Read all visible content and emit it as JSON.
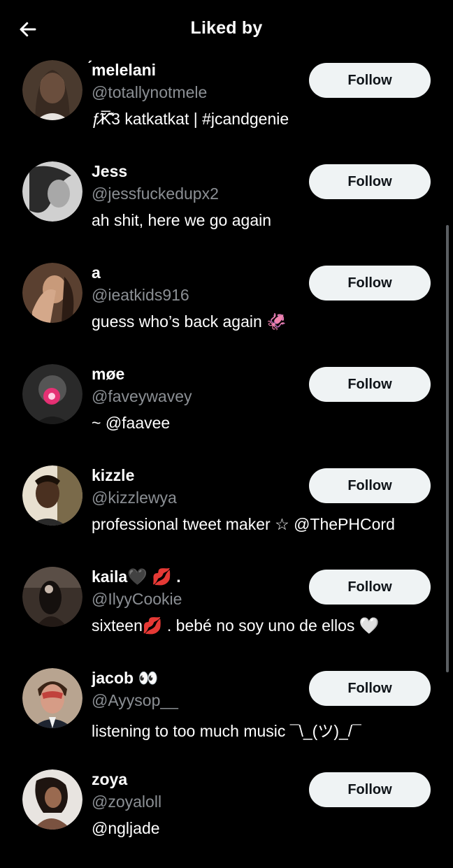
{
  "header": {
    "title": "Liked by",
    "back_icon": "arrow-left-icon"
  },
  "users": [
    {
      "name": "́melelani",
      "handle": "@totallynotmele",
      "bio": "ƒ̷̃K̅̂̌3 katkatkat | #jcandgenie",
      "follow_label": "Follow",
      "avatar_color": "#5a4636"
    },
    {
      "name": "Jess",
      "handle": "@jessfuckedupx2",
      "bio": "ah shit, here we go again",
      "follow_label": "Follow",
      "avatar_color": "#9a9a9a"
    },
    {
      "name": "a",
      "handle": "@ieatkids916",
      "bio": "guess who’s back again 🦑",
      "follow_label": "Follow",
      "avatar_color": "#7b5a44"
    },
    {
      "name": "møe",
      "handle": "@faveywavey",
      "bio": "~ @faavee",
      "follow_label": "Follow",
      "avatar_color": "#3a3a3a"
    },
    {
      "name": "kizzle",
      "handle": "@kizzlewya",
      "bio": "professional tweet maker ☆ @ThePHCord",
      "follow_label": "Follow",
      "avatar_color": "#6e5a3e"
    },
    {
      "name": "kaila🖤 💋 .",
      "handle": "@IlyyCookie",
      "bio": "sixteen💋 . bebé no soy uno de ellos 🤍",
      "follow_label": "Follow",
      "avatar_color": "#2e2622"
    },
    {
      "name": "jacob 👀",
      "handle": "@Ayysop__",
      "bio": "listening to too much music ¯\\_(ツ)_/¯",
      "follow_label": "Follow",
      "avatar_color": "#a77a66"
    },
    {
      "name": "zoya",
      "handle": "@zoyaloll",
      "bio": "@ngljade",
      "follow_label": "Follow",
      "avatar_color": "#8b6a58"
    }
  ]
}
